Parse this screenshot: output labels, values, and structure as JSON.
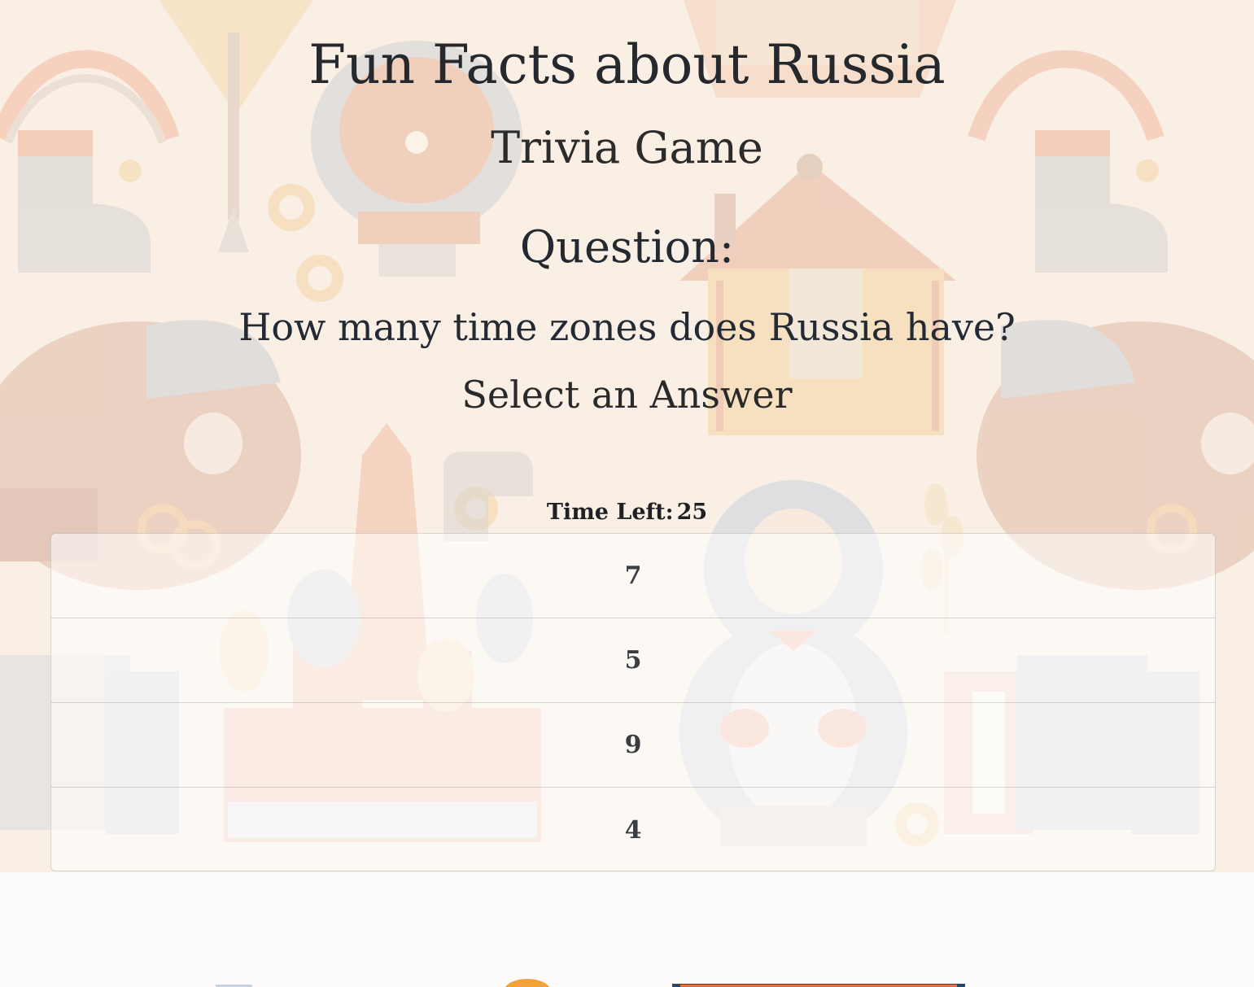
{
  "header": {
    "title": "Fun Facts about Russia",
    "subtitle": "Trivia Game"
  },
  "question": {
    "heading": "Question:",
    "text": "How many time zones does Russia have?",
    "prompt": "Select an Answer"
  },
  "timer": {
    "label": "Time Left:",
    "value": "25"
  },
  "answers": [
    {
      "label": "7"
    },
    {
      "label": "5"
    },
    {
      "label": "9"
    },
    {
      "label": "4"
    }
  ],
  "background": {
    "motifs": [
      "bear-icon",
      "matryoshka-doll-icon",
      "st-basils-cathedral-icon",
      "accordion-icon",
      "log-cabin-icon",
      "samovar-icon",
      "felt-boot-icon",
      "balalaika-icon",
      "bagel-icon",
      "wheat-icon"
    ],
    "colors": {
      "base": "#f9efe5",
      "orange": "#f3b08f",
      "blue": "#c6cfdc",
      "grey": "#d9d5d0",
      "yellow": "#f7ddb0"
    }
  }
}
